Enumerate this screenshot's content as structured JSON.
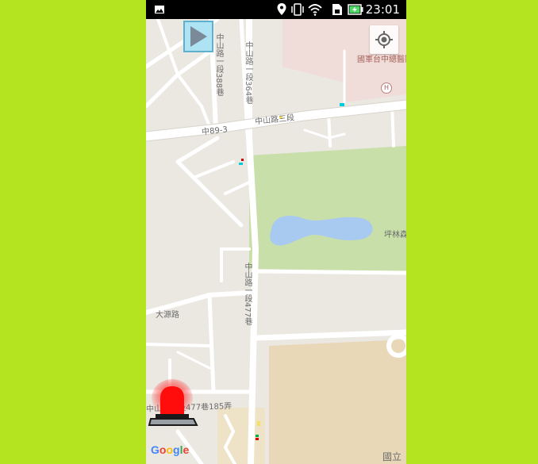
{
  "status_bar": {
    "time": "23:01",
    "icons": [
      "image-icon",
      "location-icon",
      "vibrate-icon",
      "wifi-icon",
      "sim-icon",
      "battery-icon"
    ]
  },
  "map": {
    "labels": {
      "road_left_vertical": "中山路一段388巷",
      "road_mid_vertical": "中山路一段364巷",
      "road_main_horizontal": "中山路三段",
      "road_main_code": "中89-3",
      "hospital": "國軍台中總醫院",
      "hospital_badge": "H",
      "park_right": "坪林森",
      "road_center_vertical": "中山路一段477巷",
      "datong_road": "大源路",
      "road_bottom": "中山路一段477巷185弄",
      "bottom_right": "國立"
    },
    "colors": {
      "land": "#ebe8e2",
      "park": "#c8dfaa",
      "water": "#a9caf0",
      "hospital_area": "#f0dcd8",
      "campus": "#e8d8b8",
      "road": "#ffffff"
    }
  },
  "controls": {
    "play_button": "play-icon",
    "locate_button": "locate-icon",
    "alarm_button": "alarm-siren-icon"
  },
  "branding": {
    "google": "Google"
  }
}
